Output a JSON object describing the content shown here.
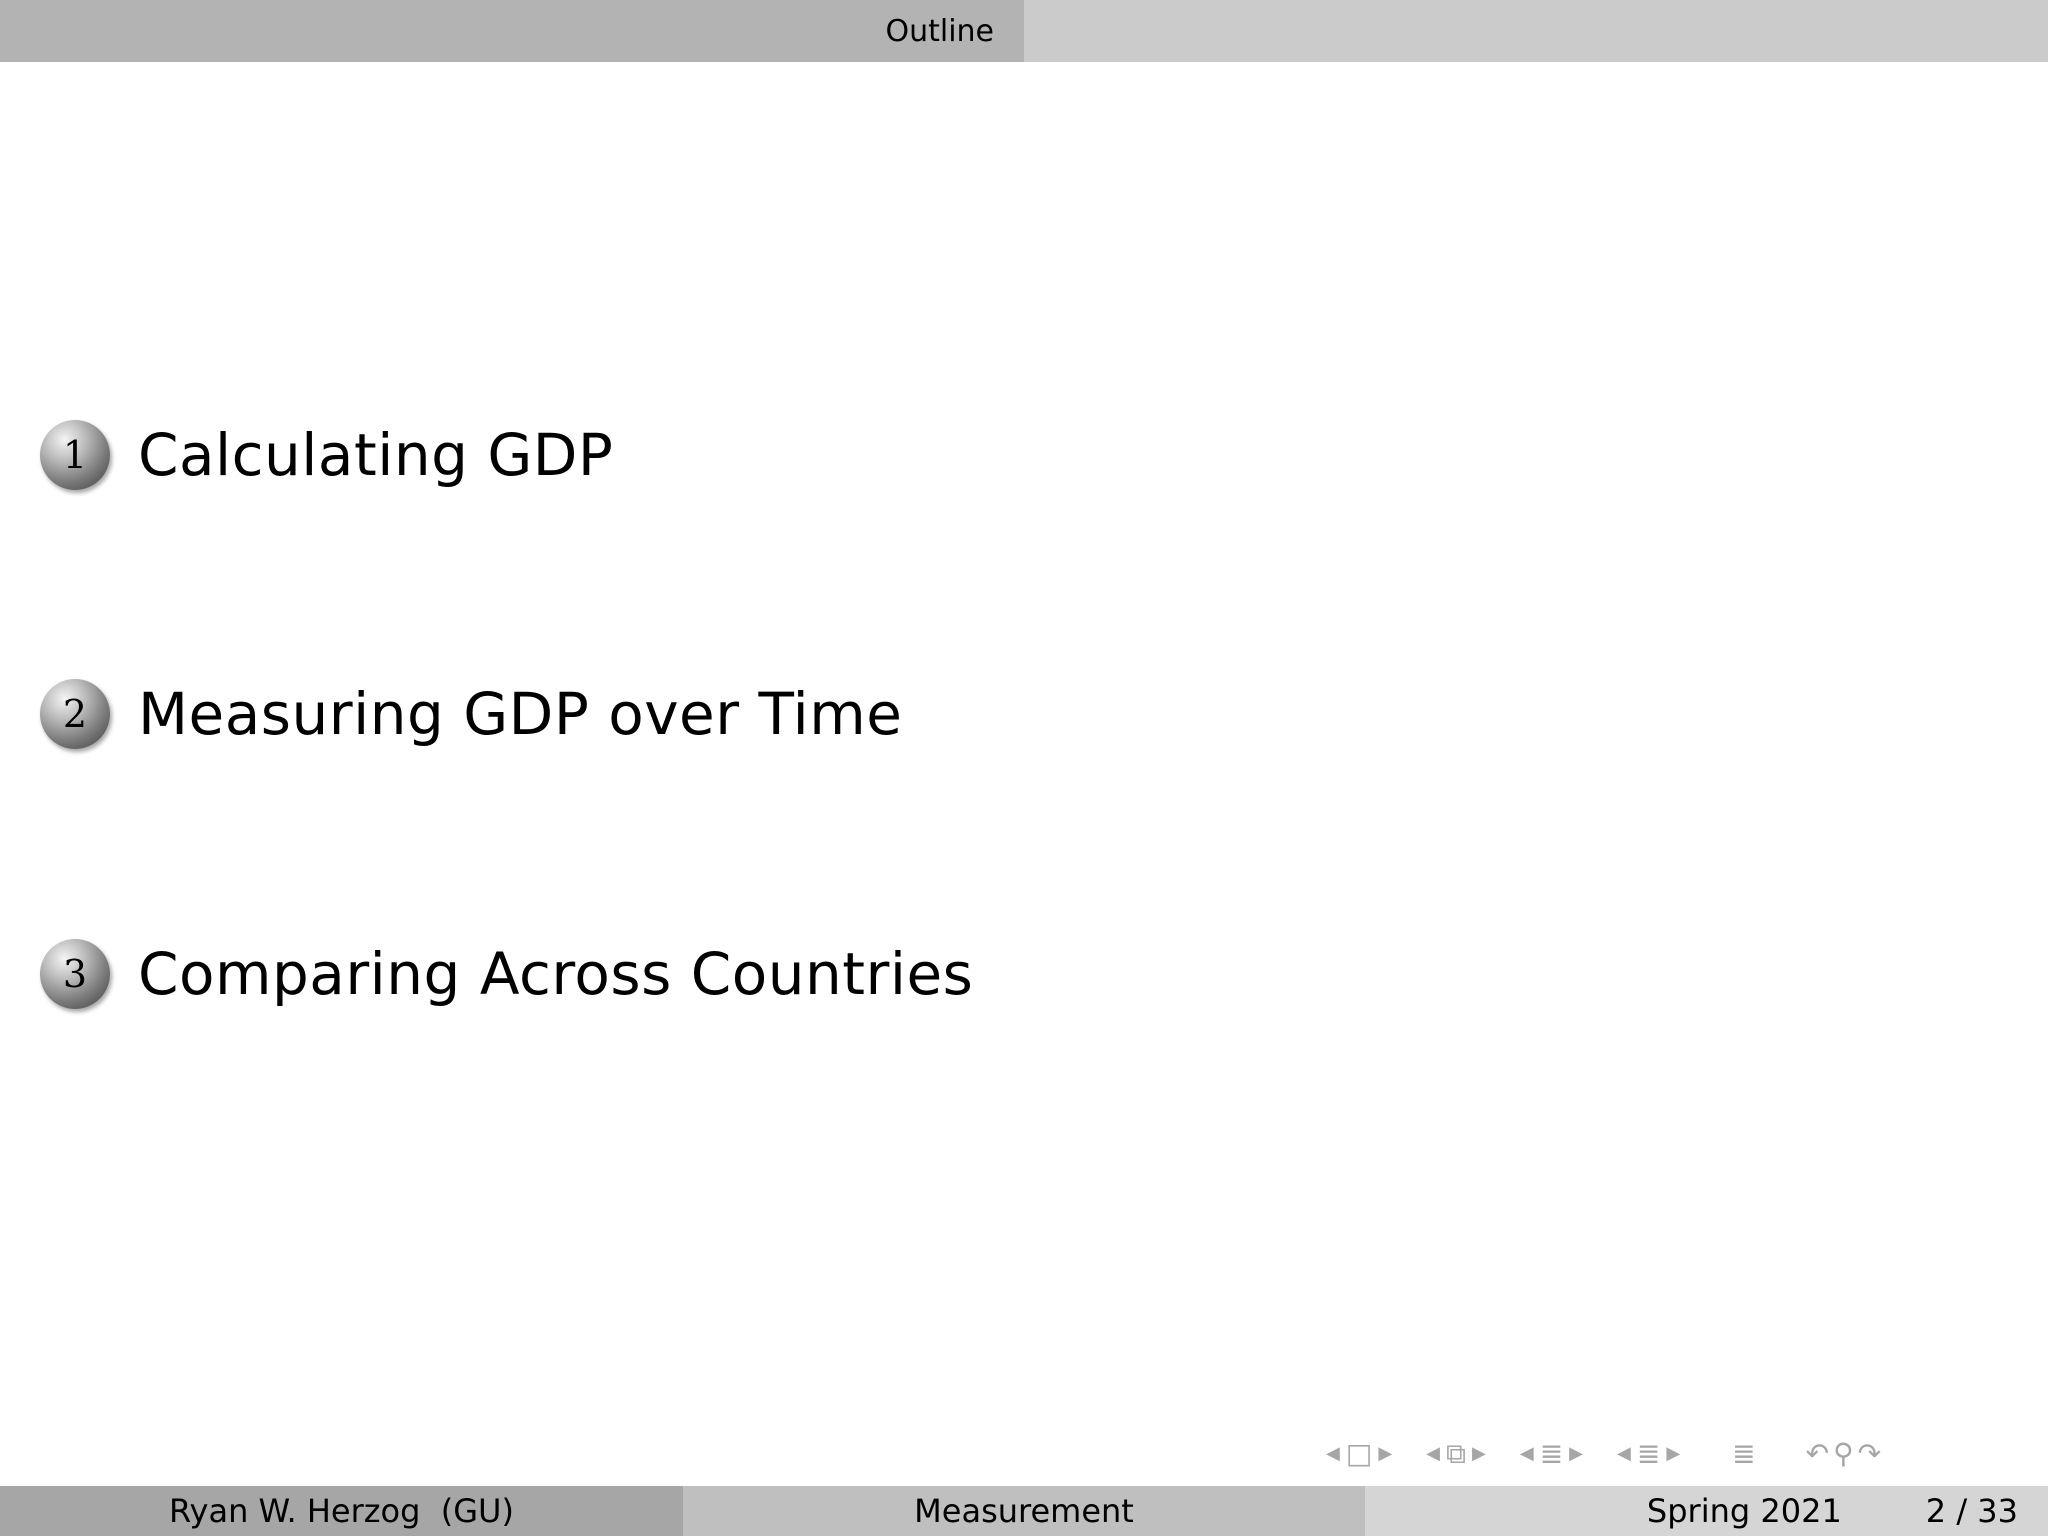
{
  "header": {
    "section_title": "Outline"
  },
  "outline": {
    "items": [
      {
        "number": "1",
        "label": "Calculating GDP"
      },
      {
        "number": "2",
        "label": "Measuring GDP over Time"
      },
      {
        "number": "3",
        "label": "Comparing Across Countries"
      }
    ]
  },
  "navigation": {
    "icons": [
      "nav-prev-frame-icon",
      "frame-icon",
      "nav-next-frame-icon",
      "nav-prev-subsection-icon",
      "subsection-icon",
      "nav-next-subsection-icon",
      "nav-prev-section-icon",
      "section-icon",
      "nav-next-section-icon",
      "nav-prev-doc-icon",
      "document-icon",
      "nav-next-doc-icon",
      "outline-icon",
      "undo-icon",
      "search-icon",
      "redo-icon"
    ]
  },
  "footer": {
    "author": "Ryan W. Herzog  (GU)",
    "title": "Measurement",
    "date": "Spring 2021",
    "page": "2 / 33"
  }
}
